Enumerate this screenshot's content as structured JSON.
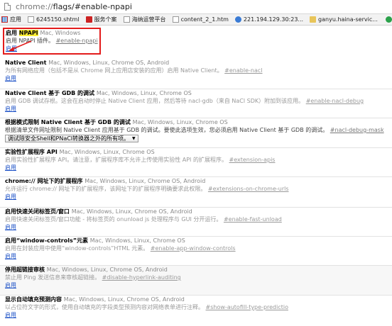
{
  "address": {
    "scheme": "chrome://",
    "path": "flags/#enable-npapi"
  },
  "bookmarks": [
    {
      "label": "应用",
      "icon": "apps-icon"
    },
    {
      "label": "6245150.shtml",
      "icon": "page-icon"
    },
    {
      "label": "服务个案",
      "icon": "gov-emblem-icon"
    },
    {
      "label": "海纳运营平台",
      "icon": "page-icon"
    },
    {
      "label": "content_2_1.htm",
      "icon": "page-icon"
    },
    {
      "label": "221.194.129.30:23...",
      "icon": "page-icon"
    },
    {
      "label": "ganyu.haina-servic...",
      "icon": "page-icon"
    }
  ],
  "experiments": [
    {
      "title": "启用 ",
      "title_hl": "NPAPI",
      "platforms": "Mac, Windows",
      "desc_pre": "启用 NPAPI 插件。",
      "anchor": "#enable-npapi",
      "link": "启用"
    },
    {
      "title": "Native Client",
      "platforms": "Mac, Windows, Linux, Chrome OS, Android",
      "desc": "为所有网络应用（包括不是从 Chrome 网上应用店安装的应用）启用 Native Client。",
      "anchor": "#enable-nacl",
      "link": "启用"
    },
    {
      "title": "Native Client 基于 GDB 的调试",
      "platforms": "Mac, Windows, Linux, Chrome OS",
      "desc": "启用 GDB 调试存根。这会在启动时停止 Native Client 应用，然后等待 nacl-gdb（来自 NaCl SDK）附加到该应用。",
      "anchor": "#enable-nacl-debug",
      "link": "启用"
    },
    {
      "title": "根据模式限制 Native Client 基于 GDB 的调试",
      "platforms": "Mac, Windows, Linux, Chrome OS",
      "desc": "根据清单文件网址限制 Native Client 应用基于 GDB 的调试。要使此选项生效，您必须启用 Native Client 基于 GDB 的调试。",
      "anchor": "#nacl-debug-mask",
      "select": "调试除安全Shell和PNaCl转换器之外的所有项。"
    },
    {
      "title": "实验性扩展程序 API",
      "platforms": "Mac, Windows, Linux, Chrome OS",
      "desc": "启用实验性扩展程序 API。请注意，扩展程序库不允许上传使用实验性 API 的扩展程序。",
      "anchor": "#extension-apis",
      "link": "启用"
    },
    {
      "title": "chrome:// 网址下的扩展程序",
      "platforms": "Mac, Windows, Linux, Chrome OS, Android",
      "desc": "允许运行 chrome:// 网址下的扩展程序，该网址下的扩展程序明确要求此权限。",
      "anchor": "#extensions-on-chrome-urls",
      "link": "启用"
    },
    {
      "title": "启用快速关闭标签页/窗口",
      "platforms": "Mac, Windows, Linux, Chrome OS, Android",
      "desc": "启用快速关闭标签页/窗口功能 - 将标签页的 onunload js 处理程序与 GUI 分开运行。",
      "anchor": "#enable-fast-unload",
      "link": "启用"
    },
    {
      "title": "启用“window-controls”元素",
      "platforms": "Mac, Windows, Linux, Chrome OS",
      "desc": "启用在封装应用中使用“window-controls”HTML 元素。",
      "anchor": "#enable-app-window-controls",
      "link": "启用"
    },
    {
      "title": "停用超链接审核",
      "platforms": "Mac, Windows, Linux, Chrome OS, Android",
      "desc": "禁止用 Ping 发送信息来审核超链接。",
      "anchor": "#disable-hyperlink-auditing",
      "link": "启用"
    },
    {
      "title": "显示自动填充预测内容",
      "platforms": "Mac, Windows, Linux, Chrome OS, Android",
      "desc": "以占位符文字的形式，使用自动填充的字段类型预测内容对网络表单进行注释。",
      "anchor": "#show-autofill-type-predictio",
      "link": "启用"
    }
  ]
}
